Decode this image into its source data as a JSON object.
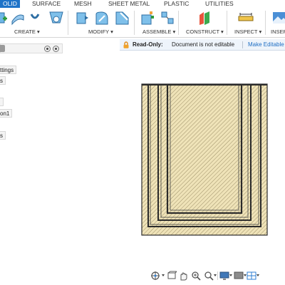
{
  "tabs": [
    "OLID",
    "SURFACE",
    "MESH",
    "SHEET METAL",
    "PLASTIC",
    "UTILITIES"
  ],
  "toolbar": {
    "groups": [
      "CREATE ▾",
      "MODIFY ▾",
      "ASSEMBLE ▾",
      "CONSTRUCT ▾",
      "INSPECT ▾",
      "INSER"
    ]
  },
  "browser": {
    "items": [
      "ttings",
      "s",
      "",
      "on1",
      "s"
    ]
  },
  "readonly": {
    "title": "Read-Only:",
    "message": "Document is not editable",
    "button": "Make Editable"
  },
  "colors": {
    "accent": "#1f73c8",
    "model_fill": "#efe3b8",
    "model_edge": "#2b2b2b"
  },
  "icons": {
    "nav": [
      "orbit-icon",
      "pan-icon",
      "zoom-icon",
      "zoom-window-icon",
      "display-settings-icon",
      "grid-icon",
      "viewports-icon"
    ]
  }
}
